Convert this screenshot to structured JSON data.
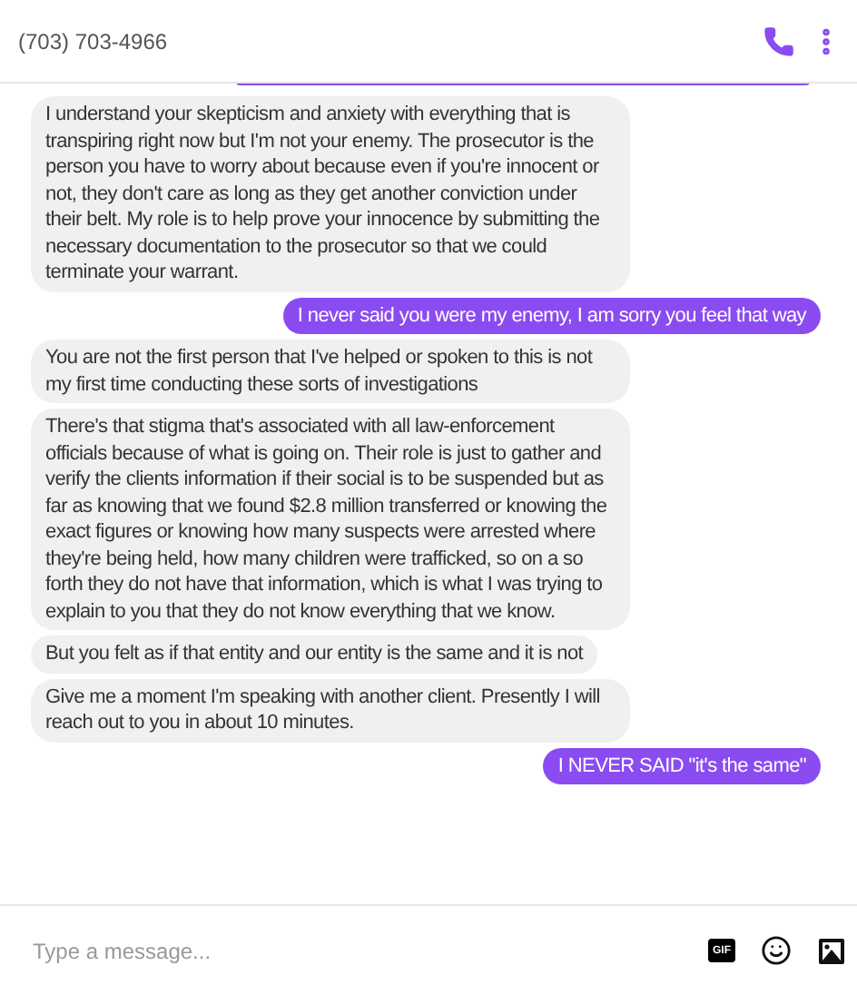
{
  "header": {
    "title": "(703) 703-4966"
  },
  "messages": [
    {
      "kind": "incoming",
      "text": "I understand your skepticism and anxiety with everything that is transpiring right now but I'm not your enemy. The prosecutor is the person you have to worry about because even if you're innocent or not, they don't care as long as they get another conviction under their belt. My role is to help prove your innocence by submitting the necessary documentation to the prosecutor so that we could terminate your warrant."
    },
    {
      "kind": "outgoing",
      "text": "I never said you were my enemy, I am sorry you feel that way"
    },
    {
      "kind": "incoming",
      "text": "You are not the first person that I've helped or spoken to this is not my first time conducting these sorts of investigations"
    },
    {
      "kind": "incoming",
      "text": "There's that stigma that's associated with all law-enforcement officials because of what is going on. Their role is just to gather and verify the clients information if their social is to be suspended but as far as knowing that we found $2.8 million transferred or knowing the exact figures or knowing how many suspects were arrested where they're being held, how many children were trafficked, so on a so forth they do not have that information, which is what I was trying to explain to you that they do not know everything that we know."
    },
    {
      "kind": "incoming",
      "text": "But you felt as if that entity and our entity is the same and it is not"
    },
    {
      "kind": "incoming",
      "text": "Give me a moment I'm speaking with another client. Presently I will reach out to you in about 10 minutes."
    },
    {
      "kind": "outgoing",
      "text": "I NEVER SAID \"it's the same\""
    }
  ],
  "composer": {
    "placeholder": "Type a message...",
    "gif_label": "GIF"
  }
}
